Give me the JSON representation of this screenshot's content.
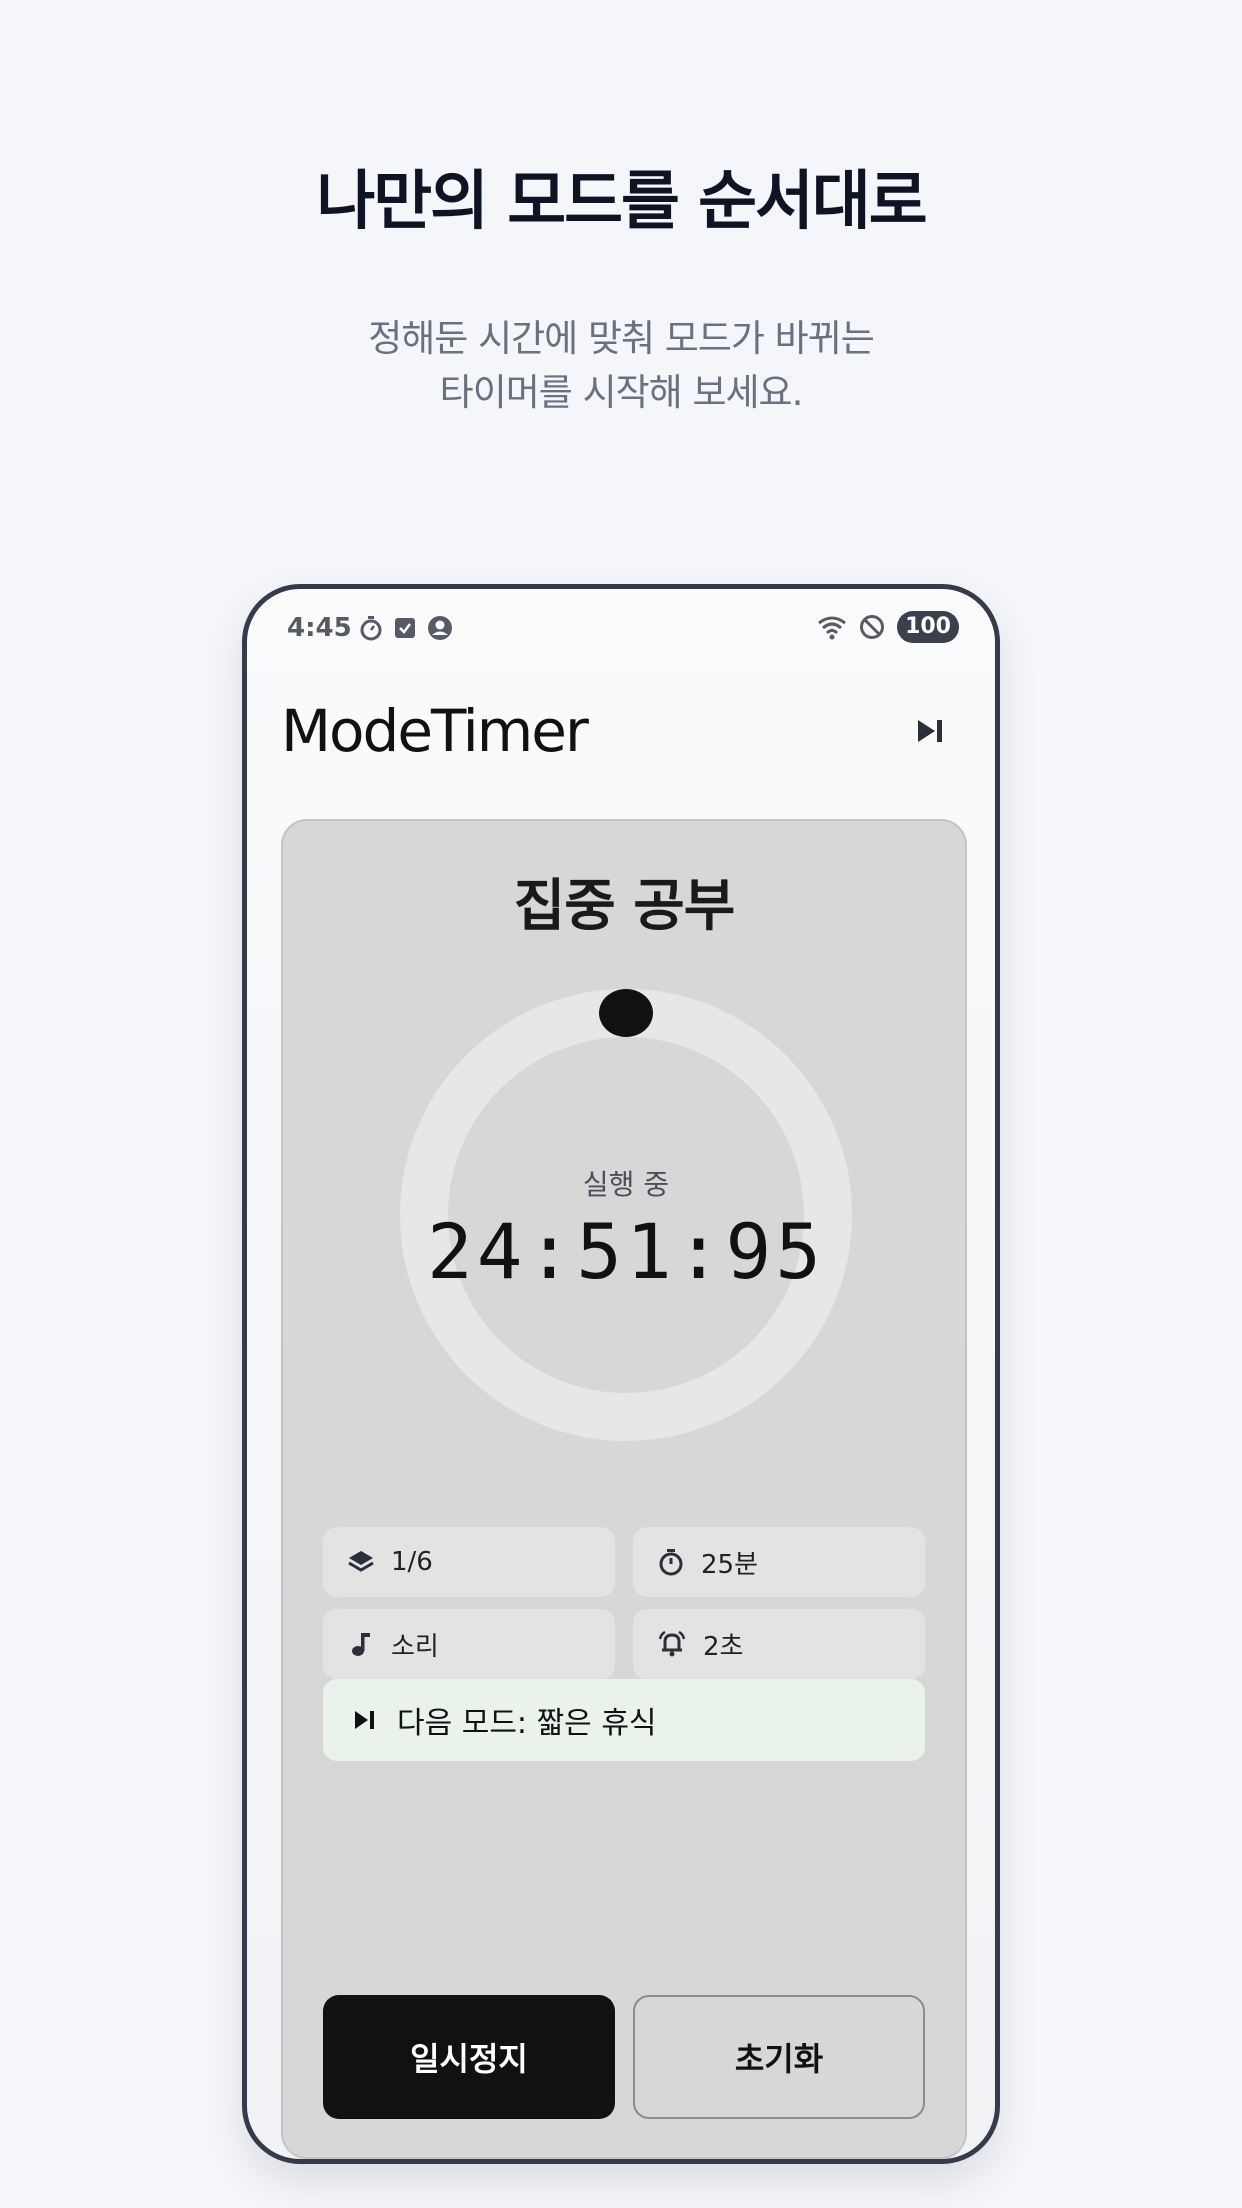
{
  "promo": {
    "headline": "나만의 모드를 순서대로",
    "subline_1": "정해둔 시간에 맞춰 모드가 바뀌는",
    "subline_2": "타이머를 시작해 보세요."
  },
  "statusbar": {
    "time": "4:45",
    "battery": "100"
  },
  "app": {
    "title": "ModeTimer"
  },
  "timer": {
    "mode_name": "집중 공부",
    "state": "실행 중",
    "remaining": "24:51:95",
    "progress_fraction": 0.0
  },
  "info": {
    "step": "1/6",
    "duration": "25분",
    "sound": "소리",
    "alarm": "2초"
  },
  "next": {
    "label": "다음 모드: 짧은 휴식"
  },
  "actions": {
    "pause": "일시정지",
    "reset": "초기화"
  },
  "colors": {
    "accent": "#111111",
    "next_bg": "#e9f3eb",
    "card_bg": "#d7d7d8"
  }
}
